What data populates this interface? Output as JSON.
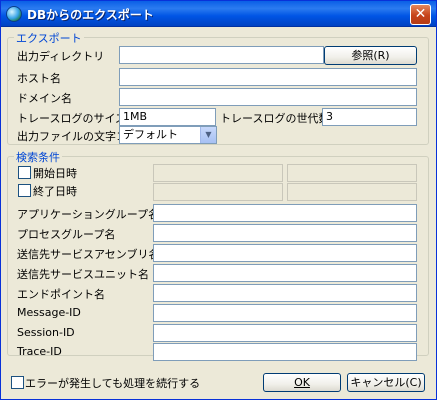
{
  "window": {
    "title": "DBからのエクスポート",
    "close_glyph": "✕"
  },
  "export_group": {
    "legend": "エクスポート",
    "output_dir_label": "出力ディレクトリ",
    "output_dir_value": "",
    "browse_button": "参照(R)",
    "host_label": "ホスト名",
    "host_value": "",
    "domain_label": "ドメイン名",
    "domain_value": "",
    "trace_size_label": "トレースログのサイズ",
    "trace_size_value": "1MB",
    "trace_gen_label": "トレースログの世代数",
    "trace_gen_value": "3",
    "charset_label": "出力ファイルの文字コード",
    "charset_value": "デフォルト",
    "charset_arrow": "▼"
  },
  "search_group": {
    "legend": "検索条件",
    "start_label": "開始日時",
    "start_checked": false,
    "end_label": "終了日時",
    "end_checked": false,
    "app_group_label": "アプリケーショングループ名",
    "process_group_label": "プロセスグループ名",
    "service_assembly_label": "送信先サービスアセンブリ名",
    "service_unit_label": "送信先サービスユニット名",
    "endpoint_label": "エンドポイント名",
    "message_id_label": "Message-ID",
    "session_id_label": "Session-ID",
    "trace_id_label": "Trace-ID"
  },
  "footer": {
    "continue_label": "エラーが発生しても処理を続行する",
    "continue_checked": false,
    "ok_button": "OK",
    "cancel_button": "キャンセル(C)"
  },
  "icons": {
    "app": "globe-icon",
    "close": "close-icon",
    "dropdown": "chevron-down-icon"
  }
}
